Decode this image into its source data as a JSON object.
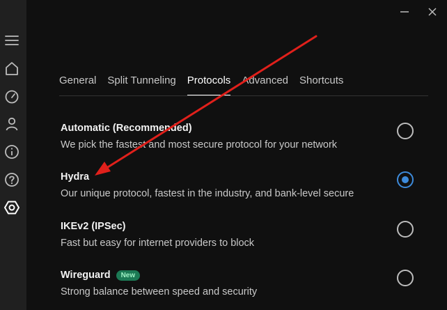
{
  "sidebar": {
    "items": [
      {
        "icon": "menu-icon"
      },
      {
        "icon": "home-icon"
      },
      {
        "icon": "speedometer-icon"
      },
      {
        "icon": "account-icon"
      },
      {
        "icon": "info-icon"
      },
      {
        "icon": "help-icon"
      },
      {
        "icon": "settings-icon",
        "active": true
      }
    ]
  },
  "window": {
    "minimize_icon": "minimize-icon",
    "close_icon": "close-icon"
  },
  "tabs": [
    {
      "label": "General"
    },
    {
      "label": "Split Tunneling"
    },
    {
      "label": "Protocols",
      "active": true
    },
    {
      "label": "Advanced"
    },
    {
      "label": "Shortcuts"
    }
  ],
  "protocols": [
    {
      "title": "Automatic (Recommended)",
      "description": "We pick the fastest and most secure protocol for your network",
      "selected": false
    },
    {
      "title": "Hydra",
      "description": "Our unique protocol, fastest in the industry, and bank-level secure",
      "selected": true
    },
    {
      "title": "IKEv2 (IPSec)",
      "description": "Fast but easy for internet providers to block",
      "selected": false
    },
    {
      "title": "Wireguard",
      "badge": "New",
      "description": "Strong balance between speed and security",
      "selected": false
    }
  ],
  "colors": {
    "accent": "#3d8bdb",
    "annotation_arrow": "#e0201b",
    "badge_bg": "#1c7a55"
  }
}
